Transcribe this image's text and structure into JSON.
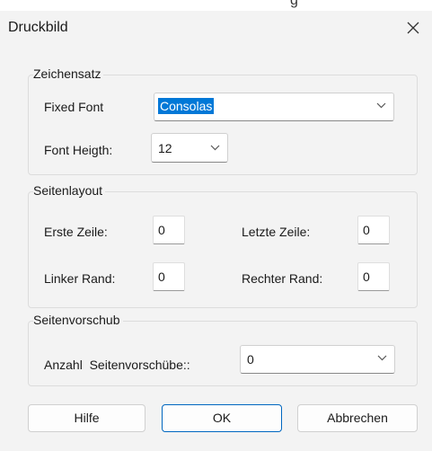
{
  "top_fragment": "g",
  "dialog": {
    "title": "Druckbild",
    "close_symbol": "×"
  },
  "zeichensatz": {
    "legend": "Zeichensatz",
    "fixed_font_label": "Fixed Font",
    "fixed_font_value": "Consolas",
    "font_height_label": "Font Heigth:",
    "font_height_value": "12"
  },
  "seitenlayout": {
    "legend": "Seitenlayout",
    "erste_zeile_label": "Erste Zeile:",
    "erste_zeile_value": "0",
    "letzte_zeile_label": "Letzte Zeile:",
    "letzte_zeile_value": "0",
    "linker_rand_label": "Linker Rand:",
    "linker_rand_value": "0",
    "rechter_rand_label": "Rechter Rand:",
    "rechter_rand_value": "0"
  },
  "seitenvorschub": {
    "legend": "Seitenvorschub",
    "anzahl_label": "Anzahl  Seitenvorschübe::",
    "anzahl_value": "0"
  },
  "buttons": {
    "help": "Hilfe",
    "ok": "OK",
    "cancel": "Abbrechen"
  },
  "colors": {
    "dialog_bg": "#f3f3f3",
    "accent": "#0078d7",
    "default_button_border": "#0067c0"
  }
}
